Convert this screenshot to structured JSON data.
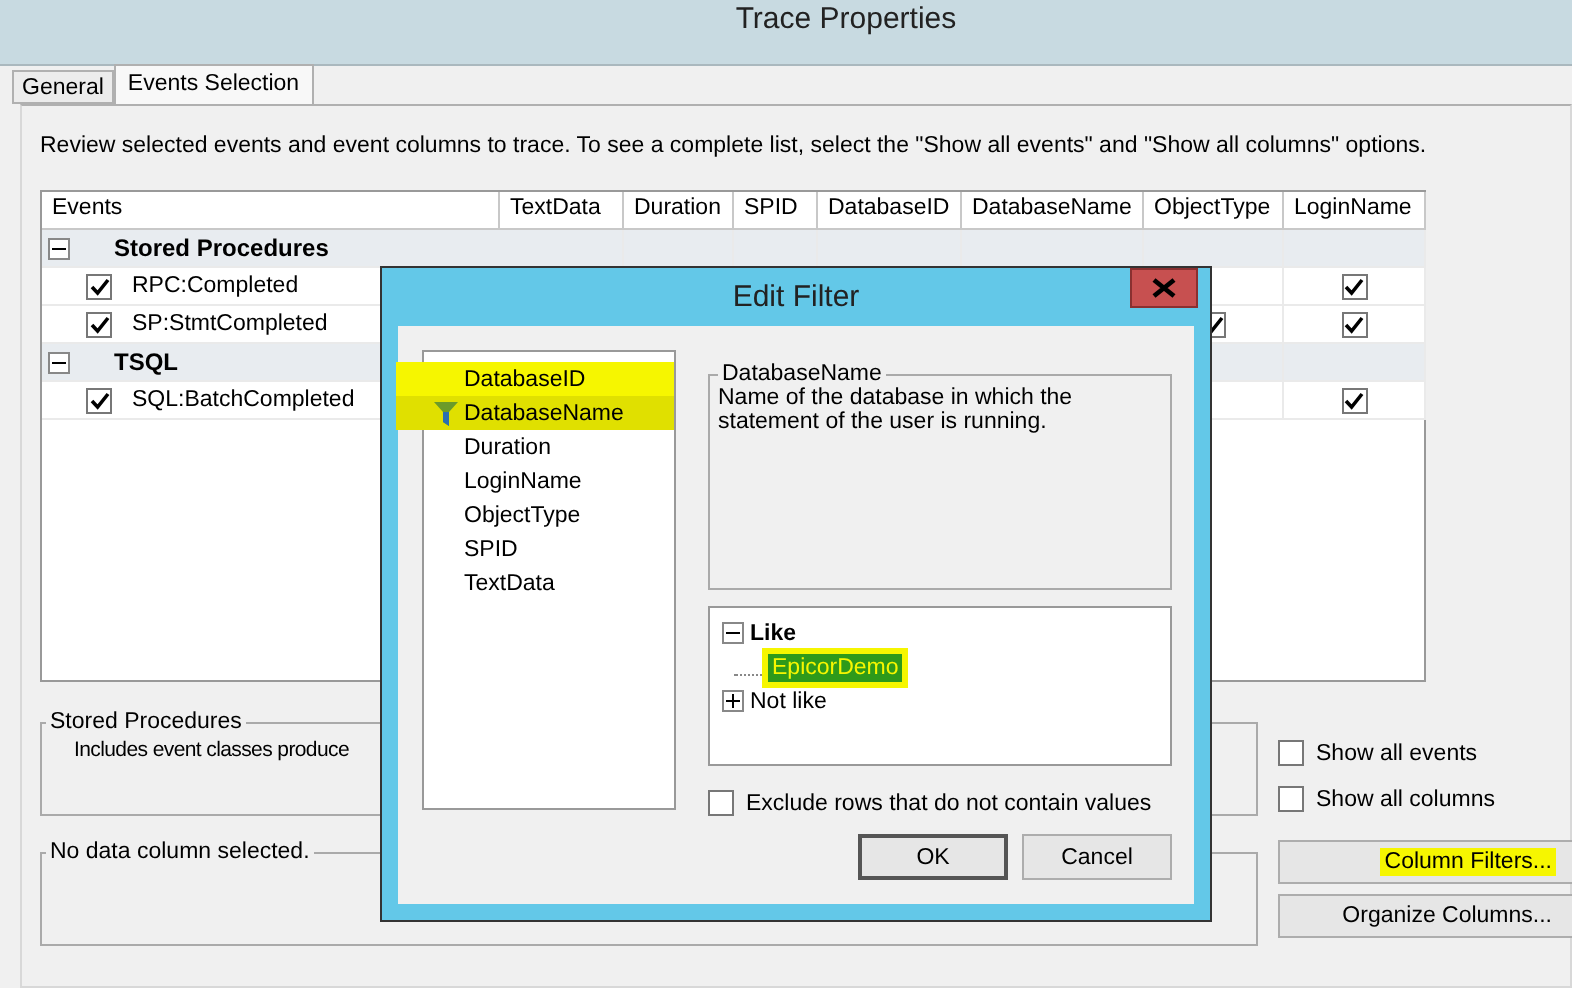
{
  "window": {
    "title": "Trace Properties"
  },
  "tabs": [
    {
      "label": "General",
      "selected": false
    },
    {
      "label": "Events Selection",
      "selected": true
    }
  ],
  "instructions": "Review selected events and event columns to trace. To see a complete list, select the \"Show all events\" and \"Show all columns\" options.",
  "events_grid": {
    "columns": [
      "Events",
      "TextData",
      "Duration",
      "SPID",
      "DatabaseID",
      "DatabaseName",
      "ObjectType",
      "LoginName"
    ],
    "groups": [
      {
        "name": "Stored Procedures",
        "expanded": true,
        "events": [
          {
            "name": "RPC:Completed",
            "checked": true,
            "object_type": false,
            "login_name": true
          },
          {
            "name": "SP:StmtCompleted",
            "checked": true,
            "object_type": true,
            "login_name": true
          }
        ]
      },
      {
        "name": "TSQL",
        "expanded": true,
        "events": [
          {
            "name": "SQL:BatchCompleted",
            "checked": true,
            "object_type": false,
            "login_name": true
          }
        ]
      }
    ]
  },
  "event_description": {
    "title": "Stored Procedures",
    "text": "Includes event classes produce"
  },
  "column_description": {
    "title": "No data column selected."
  },
  "options": [
    {
      "label": "Show all events",
      "checked": false
    },
    {
      "label": "Show all columns",
      "checked": false
    }
  ],
  "buttons": [
    {
      "label": "Column Filters...",
      "highlighted": true
    },
    {
      "label": "Organize Columns...",
      "highlighted": false
    }
  ],
  "dialog": {
    "title": "Edit Filter",
    "columns": [
      {
        "name": "DatabaseID",
        "selected": false,
        "filtered": false,
        "highlighted": true
      },
      {
        "name": "DatabaseName",
        "selected": true,
        "filtered": true,
        "highlighted": true
      },
      {
        "name": "Duration",
        "selected": false,
        "filtered": false,
        "highlighted": false
      },
      {
        "name": "LoginName",
        "selected": false,
        "filtered": false,
        "highlighted": false
      },
      {
        "name": "ObjectType",
        "selected": false,
        "filtered": false,
        "highlighted": false
      },
      {
        "name": "SPID",
        "selected": false,
        "filtered": false,
        "highlighted": false
      },
      {
        "name": "TextData",
        "selected": false,
        "filtered": false,
        "highlighted": false
      }
    ],
    "description": {
      "title": "DatabaseName",
      "text": "Name of the database in which the statement of the user is running."
    },
    "operators": [
      {
        "label": "Like",
        "expanded": true,
        "children": [
          {
            "label": "EpicorDemo",
            "selected": true,
            "highlighted": true
          }
        ]
      },
      {
        "label": "Not like",
        "expanded": false
      }
    ],
    "exclude": {
      "label": "Exclude rows that do not contain values",
      "checked": false
    },
    "buttons": [
      {
        "label": "OK",
        "default": true
      },
      {
        "label": "Cancel",
        "default": false
      }
    ]
  }
}
